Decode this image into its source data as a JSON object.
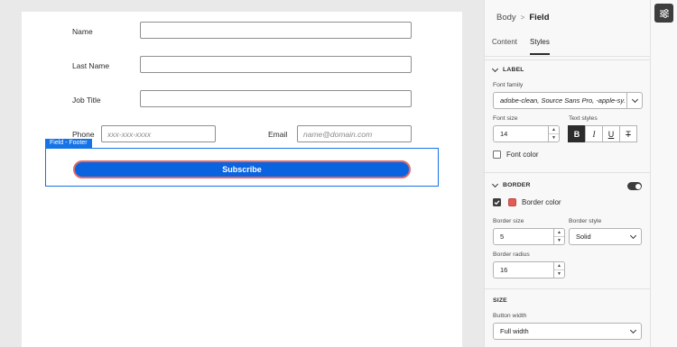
{
  "form": {
    "name_label": "Name",
    "lastname_label": "Last Name",
    "jobtitle_label": "Job Title",
    "phone_label": "Phone",
    "phone_placeholder": "xxx-xxx-xxxx",
    "email_label": "Email",
    "email_placeholder": "name@domain.com",
    "footer_tag": "Field - Footer",
    "subscribe_label": "Subscribe"
  },
  "panel": {
    "breadcrumb_parent": "Body",
    "breadcrumb_separator": ">",
    "breadcrumb_current": "Field",
    "tabs": [
      "Content",
      "Styles"
    ],
    "label_section": {
      "title": "LABEL",
      "font_family_label": "Font family",
      "font_family_value": "adobe-clean, Source Sans Pro, -apple-sy...",
      "font_size_label": "Font size",
      "font_size_value": "14",
      "text_styles_label": "Text styles",
      "text_styles": [
        "B",
        "I",
        "U",
        "T"
      ],
      "font_color_label": "Font color"
    },
    "border_section": {
      "title": "BORDER",
      "border_color_label": "Border color",
      "border_color_value": "#e45b55",
      "border_size_label": "Border size",
      "border_size_value": "5",
      "border_style_label": "Border style",
      "border_style_value": "Solid",
      "border_radius_label": "Border radius",
      "border_radius_value": "16"
    },
    "size_section": {
      "title": "SIZE",
      "button_width_label": "Button width",
      "button_width_value": "Full width"
    }
  },
  "colors": {
    "accent": "#1473e6",
    "button": "#0a64e0",
    "button_border": "#e45b55"
  }
}
